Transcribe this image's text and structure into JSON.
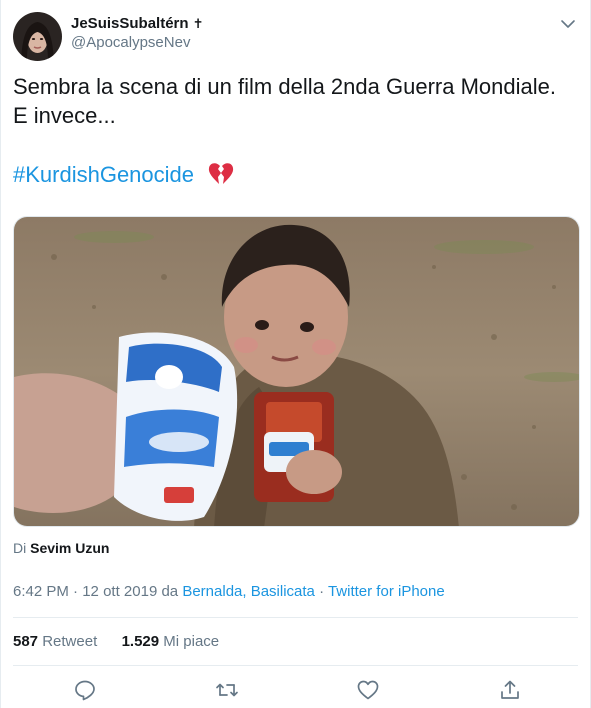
{
  "author": {
    "display_name": "JeSuisSubaltérn",
    "name_suffix": "✝",
    "handle": "@ApocalypseNev"
  },
  "tweet": {
    "text_line1": "Sembra la scena di un film della 2nda Guerra Mondiale.",
    "text_line2": "E invece...",
    "hashtag": "#KurdishGenocide",
    "emoji": "broken-heart"
  },
  "media": {
    "type": "video-thumbnail",
    "credit_prefix": "Di",
    "credit_name": "Sevim Uzun"
  },
  "meta": {
    "time": "6:42 PM",
    "separator1": " · ",
    "date": "12 ott 2019",
    "location_prefix": " da ",
    "location": "Bernalda, Basilicata",
    "separator2": " · ",
    "source": "Twitter for iPhone"
  },
  "stats": {
    "retweets_count": "587",
    "retweets_label": "Retweet",
    "likes_count": "1.529",
    "likes_label": "Mi piace"
  },
  "actions": [
    "reply-icon",
    "retweet-icon",
    "like-icon",
    "share-icon"
  ],
  "colors": {
    "link": "#1b95e0",
    "secondary_text": "#657786",
    "primary_text": "#14171a",
    "divider": "#e6ecf0"
  }
}
